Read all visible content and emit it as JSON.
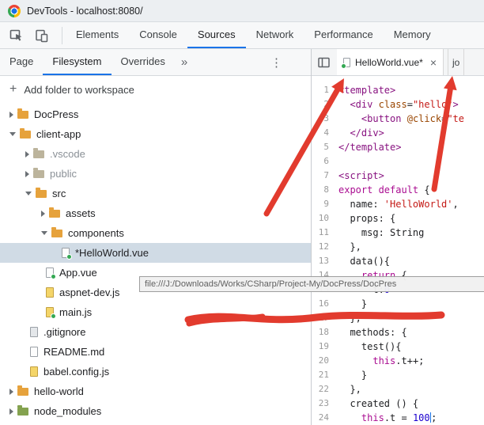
{
  "titlebar": {
    "title": "DevTools - localhost:8080/"
  },
  "toolbar": {
    "tabs": [
      "Elements",
      "Console",
      "Sources",
      "Network",
      "Performance",
      "Memory"
    ],
    "active": "Sources"
  },
  "navigator": {
    "tabs": [
      "Page",
      "Filesystem",
      "Overrides"
    ],
    "active": "Filesystem",
    "more_icon": "»",
    "menu_icon": "⋮",
    "add_folder_plus": "+",
    "add_folder_label": "Add folder to workspace",
    "tree": [
      {
        "label": "DocPress",
        "type": "folder",
        "depth": 0,
        "chevron": "collapsed",
        "folder_color": "orange"
      },
      {
        "label": "client-app",
        "type": "folder",
        "depth": 0,
        "chevron": "expanded",
        "folder_color": "orange"
      },
      {
        "label": ".vscode",
        "type": "folder",
        "depth": 1,
        "chevron": "collapsed",
        "folder_color": "muted",
        "muted": true
      },
      {
        "label": "public",
        "type": "folder",
        "depth": 1,
        "chevron": "collapsed",
        "folder_color": "muted",
        "muted": true
      },
      {
        "label": "src",
        "type": "folder",
        "depth": 1,
        "chevron": "expanded",
        "folder_color": "orange"
      },
      {
        "label": "assets",
        "type": "folder",
        "depth": 2,
        "chevron": "collapsed",
        "folder_color": "orange"
      },
      {
        "label": "components",
        "type": "folder",
        "depth": 2,
        "chevron": "expanded",
        "folder_color": "orange"
      },
      {
        "label": "*HelloWorld.vue",
        "type": "file",
        "depth": 3,
        "file_color": "white",
        "dot": true,
        "selected": true
      },
      {
        "label": "App.vue",
        "type": "file",
        "depth": 2,
        "file_color": "white",
        "dot": true
      },
      {
        "label": "aspnet-dev.js",
        "type": "file",
        "depth": 2,
        "file_color": "yellow"
      },
      {
        "label": "main.js",
        "type": "file",
        "depth": 2,
        "file_color": "yellow",
        "dot": true
      },
      {
        "label": ".gitignore",
        "type": "file",
        "depth": 1,
        "file_color": "gray"
      },
      {
        "label": "README.md",
        "type": "file",
        "depth": 1,
        "file_color": "white"
      },
      {
        "label": "babel.config.js",
        "type": "file",
        "depth": 1,
        "file_color": "yellow"
      },
      {
        "label": "hello-world",
        "type": "folder",
        "depth": 0,
        "chevron": "collapsed",
        "folder_color": "orange"
      },
      {
        "label": "node_modules",
        "type": "folder",
        "depth": 0,
        "chevron": "collapsed",
        "folder_color": "green"
      }
    ]
  },
  "editor": {
    "tabs": [
      {
        "label": "HelloWorld.vue*",
        "dot": true,
        "close": "×",
        "active": true
      },
      {
        "label": "jo",
        "active": false
      }
    ],
    "code_lines": [
      {
        "n": 1,
        "tokens": [
          [
            "tag",
            "<template>"
          ]
        ]
      },
      {
        "n": 2,
        "tokens": [
          [
            "plain",
            "  "
          ],
          [
            "tag",
            "<div"
          ],
          [
            "plain",
            " "
          ],
          [
            "attr",
            "class"
          ],
          [
            "plain",
            "="
          ],
          [
            "str",
            "\"hello\""
          ],
          [
            "tag",
            ">"
          ]
        ]
      },
      {
        "n": 3,
        "tokens": [
          [
            "plain",
            "    "
          ],
          [
            "tag",
            "<button"
          ],
          [
            "plain",
            " "
          ],
          [
            "attr",
            "@click"
          ],
          [
            "plain",
            "="
          ],
          [
            "str",
            "\"te"
          ]
        ]
      },
      {
        "n": 4,
        "tokens": [
          [
            "plain",
            "  "
          ],
          [
            "tag",
            "</div>"
          ]
        ]
      },
      {
        "n": 5,
        "tokens": [
          [
            "tag",
            "</template>"
          ]
        ]
      },
      {
        "n": 6,
        "tokens": []
      },
      {
        "n": 7,
        "tokens": [
          [
            "tag",
            "<script>"
          ]
        ]
      },
      {
        "n": 8,
        "tokens": [
          [
            "kw",
            "export default"
          ],
          [
            "plain",
            " {"
          ]
        ]
      },
      {
        "n": 9,
        "tokens": [
          [
            "plain",
            "  name: "
          ],
          [
            "str",
            "'HelloWorld'"
          ],
          [
            "plain",
            ","
          ]
        ]
      },
      {
        "n": 10,
        "tokens": [
          [
            "plain",
            "  props: {"
          ]
        ]
      },
      {
        "n": 11,
        "tokens": [
          [
            "plain",
            "    msg: String"
          ]
        ]
      },
      {
        "n": 12,
        "tokens": [
          [
            "plain",
            "  },"
          ]
        ]
      },
      {
        "n": 13,
        "tokens": [
          [
            "plain",
            "  data(){"
          ]
        ]
      },
      {
        "n": 14,
        "tokens": [
          [
            "plain",
            "    "
          ],
          [
            "kw",
            "return"
          ],
          [
            "plain",
            " {"
          ]
        ]
      },
      {
        "n": 15,
        "tokens": [
          [
            "plain",
            "      t:"
          ],
          [
            "num",
            "0"
          ]
        ]
      },
      {
        "n": 16,
        "tokens": [
          [
            "plain",
            "    }"
          ]
        ]
      },
      {
        "n": 17,
        "tokens": [
          [
            "plain",
            "  },"
          ]
        ]
      },
      {
        "n": 18,
        "tokens": [
          [
            "plain",
            "  methods: {"
          ]
        ]
      },
      {
        "n": 19,
        "tokens": [
          [
            "plain",
            "    test(){"
          ]
        ]
      },
      {
        "n": 20,
        "tokens": [
          [
            "plain",
            "      "
          ],
          [
            "kw",
            "this"
          ],
          [
            "plain",
            ".t++;"
          ]
        ]
      },
      {
        "n": 21,
        "tokens": [
          [
            "plain",
            "    }"
          ]
        ]
      },
      {
        "n": 22,
        "tokens": [
          [
            "plain",
            "  },"
          ]
        ]
      },
      {
        "n": 23,
        "tokens": [
          [
            "plain",
            "  created () {"
          ]
        ]
      },
      {
        "n": 24,
        "tokens": [
          [
            "plain",
            "    "
          ],
          [
            "kw",
            "this"
          ],
          [
            "plain",
            ".t = "
          ],
          [
            "num",
            "100"
          ],
          [
            "caret",
            ""
          ],
          [
            "plain",
            ";"
          ]
        ]
      }
    ]
  },
  "tooltip": {
    "text": "file:///J:/Downloads/Works/CSharp/Project-My/DocPress/DocPres"
  },
  "colors": {
    "accent_blue": "#1a73e8",
    "annotation_red": "#e23b2e",
    "modified_green": "#34a853",
    "folder_orange": "#e6a23c"
  }
}
